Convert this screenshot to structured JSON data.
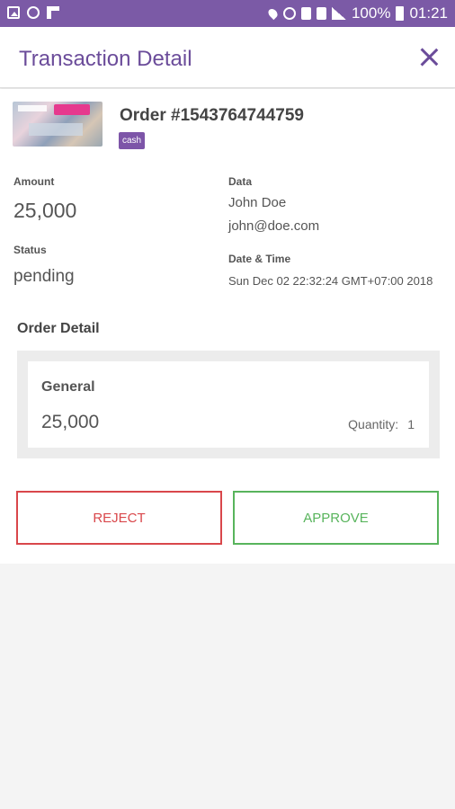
{
  "status_bar": {
    "battery": "100%",
    "time": "01:21",
    "left_icons": [
      "gallery-icon",
      "whatsapp-icon",
      "flipboard-icon"
    ],
    "right_icons": [
      "location-icon",
      "alarm-icon",
      "vibrate-icon",
      "sim-icon",
      "data-icon",
      "signal-icon",
      "battery-icon"
    ]
  },
  "header": {
    "title": "Transaction Detail",
    "close_icon": "close-icon"
  },
  "order": {
    "title": "Order #1543764744759",
    "payment_badge": "cash"
  },
  "details": {
    "amount_label": "Amount",
    "amount_value": "25,000",
    "data_label": "Data",
    "customer_name": "John Doe",
    "customer_email": "john@doe.com",
    "status_label": "Status",
    "status_value": "pending",
    "datetime_label": "Date & Time",
    "datetime_value": "Sun Dec 02 22:32:24 GMT+07:00 2018"
  },
  "order_detail": {
    "section_title": "Order Detail",
    "items": [
      {
        "name": "General",
        "price": "25,000",
        "quantity_label": "Quantity:",
        "quantity": "1"
      }
    ]
  },
  "actions": {
    "reject_label": "REJECT",
    "approve_label": "APPROVE"
  },
  "colors": {
    "status_bar": "#7b5aa6",
    "accent": "#6b4c9a",
    "reject": "#d9474b",
    "approve": "#58b45c"
  }
}
